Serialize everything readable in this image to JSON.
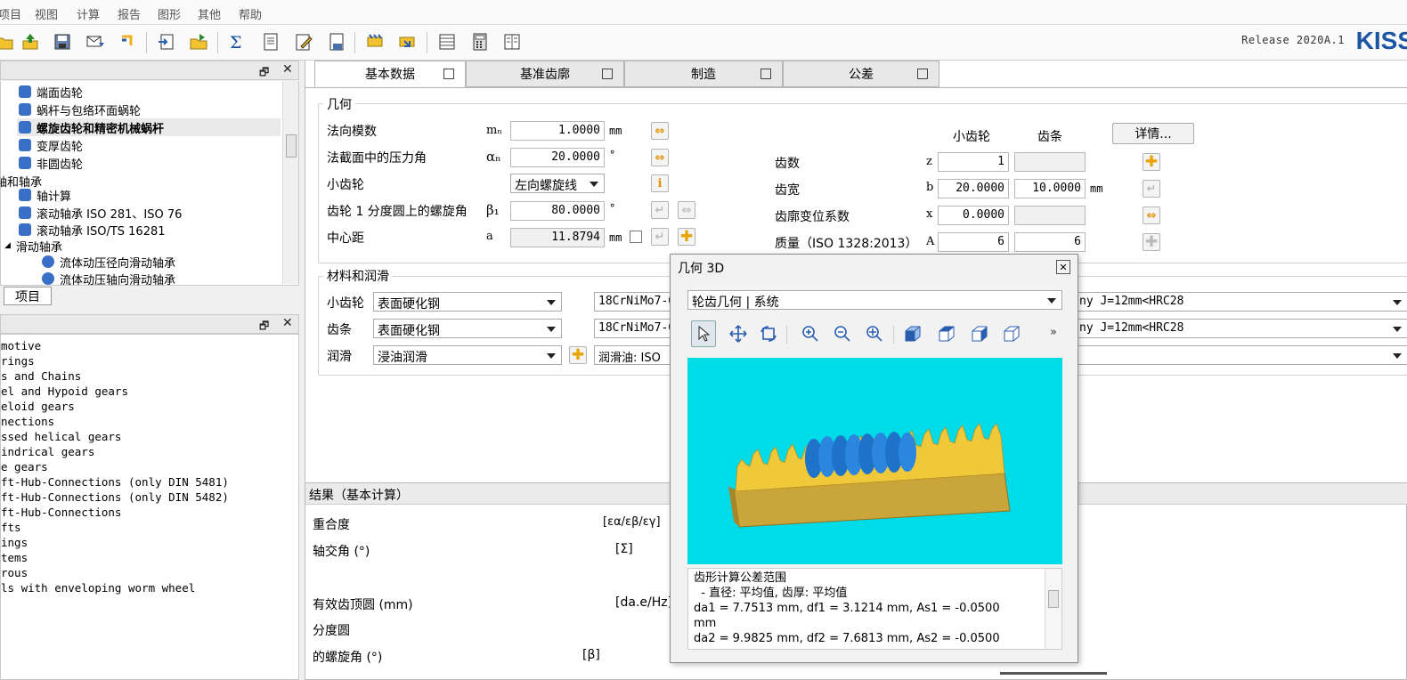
{
  "menu": [
    "项目",
    "视图",
    "计算",
    "报告",
    "图形",
    "其他",
    "帮助"
  ],
  "toolbar": {
    "release": "Release 2020A.1",
    "logo": "KISS"
  },
  "tree": {
    "items": [
      {
        "label": "端面齿轮",
        "color": "#3a6fc7"
      },
      {
        "label": "蜗杆与包络环面蜗轮",
        "color": "#3a6fc7"
      },
      {
        "label": "螺旋齿轮和精密机械蜗杆",
        "color": "#3a6fc7",
        "bold": true
      },
      {
        "label": "变厚齿轮",
        "color": "#3a6fc7"
      },
      {
        "label": "非圆齿轮",
        "color": "#3a6fc7"
      },
      {
        "label": "轴和轴承",
        "color": ""
      },
      {
        "label": "轴计算",
        "color": "#3a6fc7"
      },
      {
        "label": "滚动轴承 ISO 281、ISO 76",
        "color": "#3a6fc7"
      },
      {
        "label": "滚动轴承 ISO/TS 16281",
        "color": "#3a6fc7"
      },
      {
        "label": "滑动轴承",
        "color": ""
      },
      {
        "label": "流体动压径向滑动轴承",
        "color": "#3a6fc7"
      },
      {
        "label": "流体动压轴向滑动轴承",
        "color": "#3a6fc7"
      }
    ],
    "tab_label": "项目"
  },
  "list": {
    "items": [
      "motive",
      "rings",
      "s and Chains",
      "el and Hypoid gears",
      "eloid gears",
      "nections",
      "ssed helical gears",
      "indrical gears",
      "e gears",
      "ft-Hub-Connections (only DIN 5481)",
      "ft-Hub-Connections (only DIN 5482)",
      "ft-Hub-Connections",
      "fts",
      "ings",
      "tems",
      "rous",
      "ls with enveloping worm wheel"
    ]
  },
  "tabs": [
    "基本数据",
    "基准齿廓",
    "制造",
    "公差"
  ],
  "geometry": {
    "title": "几何",
    "normal_module": {
      "label": "法向模数",
      "sym": "mₙ",
      "value": "1.0000",
      "unit": "mm"
    },
    "pressure_angle": {
      "label": "法截面中的压力角",
      "sym": "αₙ",
      "value": "20.0000",
      "unit": "°"
    },
    "pinion": {
      "label": "小齿轮",
      "value": "左向螺旋线"
    },
    "helix_angle": {
      "label": "齿轮 1 分度圆上的螺旋角",
      "sym": "β₁",
      "value": "80.0000",
      "unit": "°"
    },
    "center_distance": {
      "label": "中心距",
      "sym": "a",
      "value": "11.8794",
      "unit": "mm"
    },
    "col_pinion": "小齿轮",
    "col_rack": "齿条",
    "details_btn": "详情...",
    "teeth": {
      "label": "齿数",
      "sym": "z",
      "v1": "1",
      "v2": ""
    },
    "width": {
      "label": "齿宽",
      "sym": "b",
      "v1": "20.0000",
      "v2": "10.0000",
      "unit": "mm"
    },
    "shift": {
      "label": "齿廓变位系数",
      "sym": "x",
      "v1": "0.0000",
      "v2": ""
    },
    "quality": {
      "label": "质量（ISO 1328:2013）",
      "sym": "A",
      "v1": "6",
      "v2": "6"
    }
  },
  "material": {
    "title": "材料和润滑",
    "pinion": {
      "label": "小齿轮",
      "type": "表面硬化钢",
      "mat": "18CrNiMo7-6",
      "suffix": "ny J=12mm<HRC28"
    },
    "rack": {
      "label": "齿条",
      "type": "表面硬化钢",
      "mat": "18CrNiMo7-6",
      "suffix": "ny J=12mm<HRC28"
    },
    "lube": {
      "label": "润滑",
      "type": "浸油润滑",
      "oil": "润滑油: ISO"
    }
  },
  "results": {
    "title": "结果（基本计算）",
    "rows": [
      {
        "label": "重合度",
        "sym": "[εα/εβ/εγ]"
      },
      {
        "label": "轴交角 (°)",
        "sym": "[Σ]"
      },
      {
        "label": "有效齿顶圆 (mm)",
        "sym": "[da.e/Hz]"
      },
      {
        "label": "分度圆",
        "sym": ""
      },
      {
        "label": "的螺旋角 (°)",
        "sym": "[β]"
      }
    ]
  },
  "dialog": {
    "title": "几何 3D",
    "close": "☒",
    "view_select": "轮齿几何 | 系统",
    "more": "»",
    "text": "齿形计算公差范围\n  - 直径: 平均值, 齿厚: 平均值\nda1 = 7.7513 mm, df1 = 3.1214 mm, As1 = -0.0500\nmm\nda2 = 9.9825 mm, df2 = 7.6813 mm, As2 = -0.0500"
  }
}
